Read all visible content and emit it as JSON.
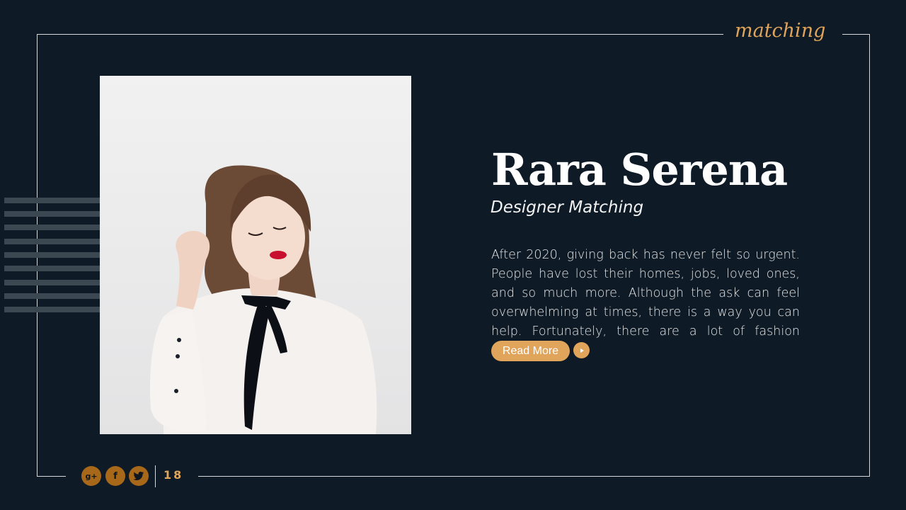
{
  "slide": {
    "brand_script": "matching",
    "name": "Rara Serena",
    "role": "Designer Matching",
    "description": "After 2020, giving back has never felt so urgent. People have lost their homes, jobs, loved ones, and so much more. Although the ask can feel overwhelming at times, there is a way you can help. Fortunately, there are a lot of fashion retailers.",
    "read_more_label": "Read More",
    "page_number": "18"
  },
  "social": {
    "google_label": "g+",
    "facebook_label": "f"
  },
  "icons": [
    "play-icon",
    "google-plus-icon",
    "facebook-icon",
    "twitter-icon"
  ],
  "colors": {
    "background": "#0e1b27",
    "accent": "#e0a45b",
    "social_bg": "#a8681a",
    "frame": "#d6d9dc",
    "stripes": "#3b4852"
  }
}
